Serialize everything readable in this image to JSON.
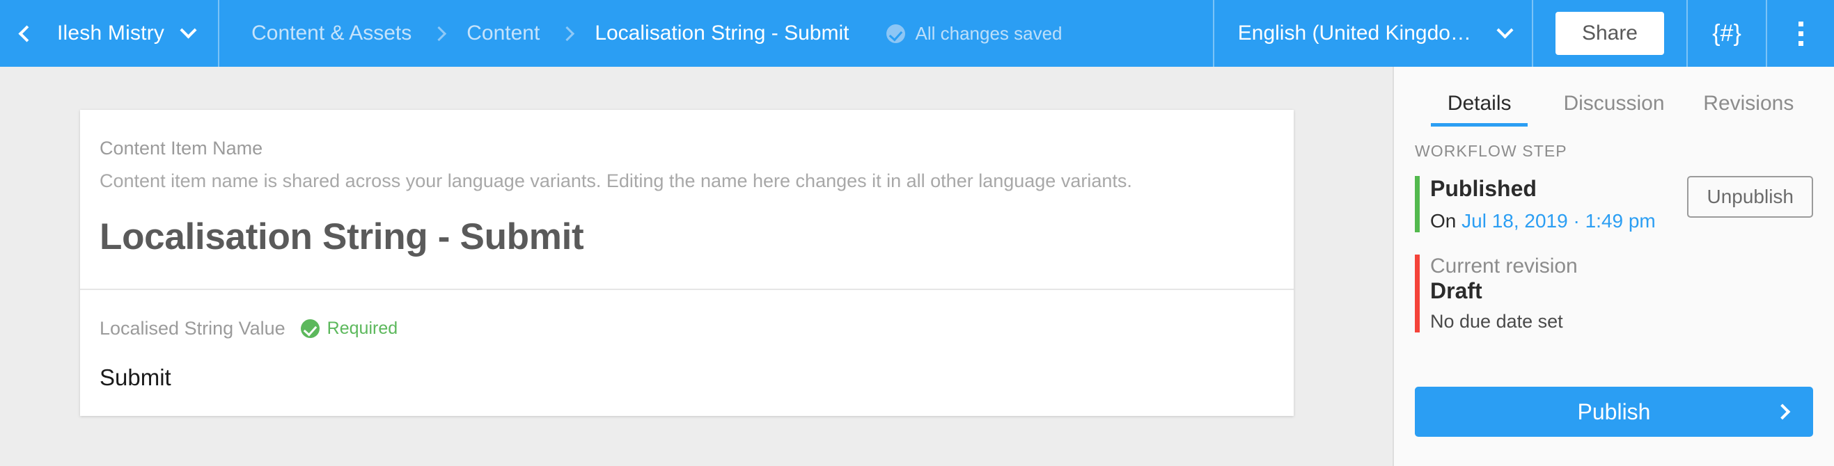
{
  "header": {
    "back_icon": "chevron-left-icon",
    "user_name": "Ilesh Mistry",
    "user_caret_icon": "chevron-down-icon",
    "breadcrumbs": [
      {
        "label": "Content & Assets",
        "active": false
      },
      {
        "label": "Content",
        "active": false
      },
      {
        "label": "Localisation String - Submit",
        "active": true
      }
    ],
    "save_status": "All changes saved",
    "save_status_icon": "check-circle-icon",
    "language": "English (United Kingdo…",
    "language_caret_icon": "chevron-down-icon",
    "share_label": "Share",
    "code_label": "{#}",
    "more_icon": "kebab-menu-icon"
  },
  "main": {
    "name_field": {
      "label": "Content Item Name",
      "help": "Content item name is shared across your language variants. Editing the name here changes it in all other language variants.",
      "value": "Localisation String - Submit"
    },
    "string_field": {
      "label": "Localised String Value",
      "required_label": "Required",
      "required_icon": "check-circle-icon",
      "value": "Submit"
    }
  },
  "sidebar": {
    "tabs": [
      {
        "label": "Details",
        "active": true
      },
      {
        "label": "Discussion",
        "active": false
      },
      {
        "label": "Revisions",
        "active": false
      }
    ],
    "workflow_heading": "WORKFLOW STEP",
    "published": {
      "title": "Published",
      "date_prefix": "On",
      "date": "Jul 18, 2019 · 1:49 pm",
      "action_label": "Unpublish",
      "accent_color": "#53b94e"
    },
    "revision": {
      "subtitle": "Current revision",
      "title": "Draft",
      "note": "No due date set",
      "accent_color": "#f4433a"
    },
    "publish_button": {
      "label": "Publish",
      "chevron_icon": "chevron-right-icon",
      "color": "#2b9ef3"
    }
  }
}
